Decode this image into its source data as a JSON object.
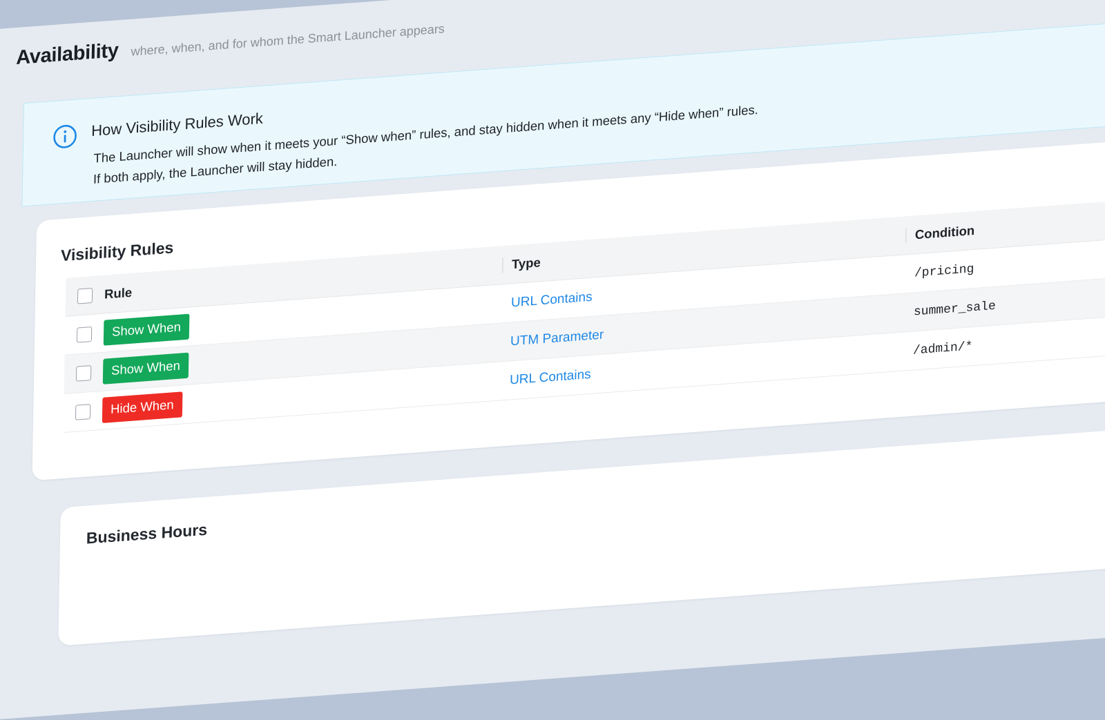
{
  "header": {
    "title": "Availability",
    "subtitle": "where, when, and for whom the Smart Launcher appears"
  },
  "info": {
    "title": "How Visibility Rules Work",
    "line1": "The Launcher will show when it meets your “Show when” rules, and stay hidden when it meets any “Hide when” rules.",
    "line2": "If both apply, the Launcher will stay hidden.",
    "icon": "info-icon",
    "accent": "#1e88e5"
  },
  "visibility_rules": {
    "title": "Visibility Rules",
    "columns": {
      "rule": "Rule",
      "type": "Type",
      "condition": "Condition"
    },
    "rows": [
      {
        "rule": "Show When",
        "type": "URL Contains",
        "condition": "/pricing"
      },
      {
        "rule": "Show When",
        "type": "UTM Parameter",
        "condition": "summer_sale"
      },
      {
        "rule": "Hide When",
        "type": "URL Contains",
        "condition": "/admin/*"
      }
    ],
    "colors": {
      "show": "#14a85a",
      "hide": "#ee2c25",
      "link": "#1e88e5"
    }
  },
  "business_hours": {
    "title": "Business Hours"
  }
}
